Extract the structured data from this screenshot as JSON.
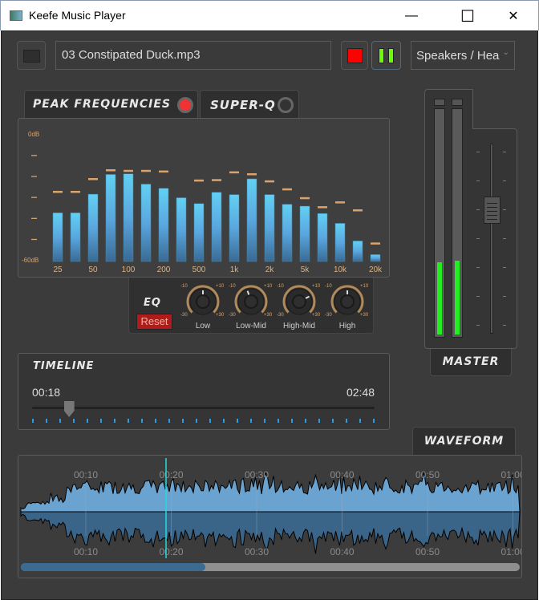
{
  "window": {
    "title": "Keefe Music Player",
    "minimize": "—",
    "maximize": "☐",
    "close": "✕"
  },
  "toolbar": {
    "open_icon": "folder-icon",
    "file_name": "03 Constipated Duck.mp3",
    "stop_color": "#ff0000",
    "pause_color": "#66ff00",
    "output_device": "Speakers / Hea"
  },
  "tabs": {
    "peak": "Peak Frequencies",
    "superq": "Super-Q",
    "peak_led": "on",
    "superq_led": "off",
    "master": "Master",
    "waveform": "Waveform",
    "timeline": "Timeline",
    "eq": "EQ"
  },
  "chart_data": {
    "type": "bar",
    "ylim": [
      -60,
      0
    ],
    "y_tick_labels": [
      "0dB",
      "-60dB"
    ],
    "x_tick_labels": [
      "25",
      "",
      "50",
      "",
      "100",
      "",
      "200",
      "",
      "500",
      "",
      "1k",
      "",
      "2k",
      "",
      "5k",
      "",
      "10k",
      "",
      "20k"
    ],
    "series": [
      {
        "values": [
          -37.6,
          -37.6,
          -28.7,
          -19.3,
          -19,
          -23.9,
          -25.9,
          -30.4,
          -33.2,
          -27.8,
          -28.9,
          -21.4,
          -28.9,
          -33.5,
          -34.4,
          -37.9,
          -42.6,
          -51,
          -57.5
        ]
      },
      {
        "values": [
          -27.5,
          -27.5,
          -21.4,
          -17.2,
          -17.5,
          -17.5,
          -17.8,
          null,
          -22.1,
          -21.9,
          -18.2,
          -19.1,
          -22.5,
          -26.3,
          -30.5,
          -34.8,
          -32.5,
          -36.3,
          -52.1
        ]
      }
    ],
    "bar_color": "#5ec8f0",
    "peak_color": "#d9a36b"
  },
  "eq": {
    "reset": "Reset",
    "scale": {
      "min": "-30",
      "max": "+30",
      "lo": "-10",
      "hi": "+10"
    },
    "knobs": [
      {
        "label": "Low",
        "value": 0
      },
      {
        "label": "Low-Mid",
        "value": -4
      },
      {
        "label": "High-Mid",
        "value": 14
      },
      {
        "label": "High",
        "value": 0
      }
    ]
  },
  "timeline": {
    "current": "00:18",
    "total": "02:48",
    "progress": 0.107
  },
  "master": {
    "meter_left": 0.32,
    "meter_right": 0.33,
    "volume": 0.65,
    "meter_color": "#22ee22"
  },
  "waveform": {
    "time_labels": [
      "00:10",
      "00:20",
      "00:30",
      "00:40",
      "00:50",
      "01:00"
    ],
    "playhead_color": "#22dddd",
    "scroll_fraction": 0.37
  }
}
